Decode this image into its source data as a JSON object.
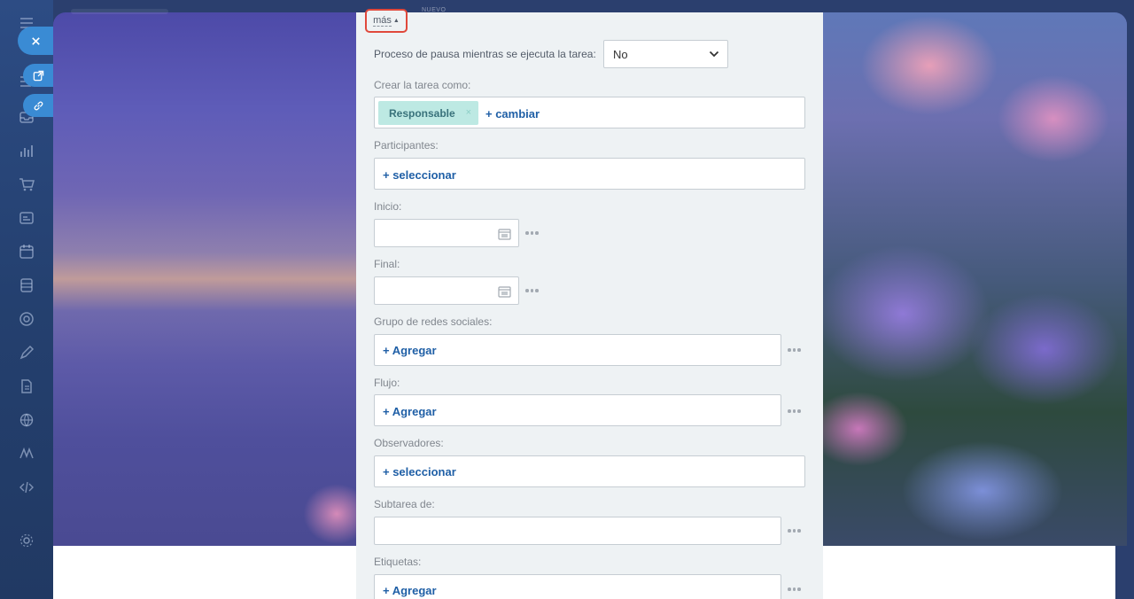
{
  "nav": {
    "icons": [
      "menu-icon",
      "tasks-icon",
      "inbox-icon",
      "chart-icon",
      "cart-icon",
      "contact-card-icon",
      "calendar-icon",
      "database-icon",
      "target-icon",
      "pen-icon",
      "document-icon",
      "globe-icon",
      "brand-icon",
      "code-icon",
      "settings-icon"
    ]
  },
  "background": {
    "top_label": "NUEVO"
  },
  "toggle": {
    "label": "más",
    "caret": "▲"
  },
  "form": {
    "pause": {
      "label": "Proceso de pausa mientras se ejecuta la tarea:",
      "value": "No"
    },
    "create_as": {
      "label": "Crear la tarea como:",
      "chip": "Responsable",
      "chip_remove": "×",
      "action": "+ cambiar"
    },
    "participants": {
      "label": "Participantes:",
      "action": "+ seleccionar"
    },
    "start": {
      "label": "Inicio:",
      "value": ""
    },
    "end": {
      "label": "Final:",
      "value": ""
    },
    "social_group": {
      "label": "Grupo de redes sociales:",
      "action": "+ Agregar"
    },
    "flow": {
      "label": "Flujo:",
      "action": "+ Agregar"
    },
    "observers": {
      "label": "Observadores:",
      "action": "+ seleccionar"
    },
    "subtask_of": {
      "label": "Subtarea de:",
      "value": ""
    },
    "tags": {
      "label": "Etiquetas:",
      "action": "+ Agregar"
    }
  },
  "colors": {
    "link": "#1f5fa6",
    "chip_bg": "#bde9e3",
    "highlight": "#e0483b",
    "accent_button": "#3a8bd4"
  }
}
